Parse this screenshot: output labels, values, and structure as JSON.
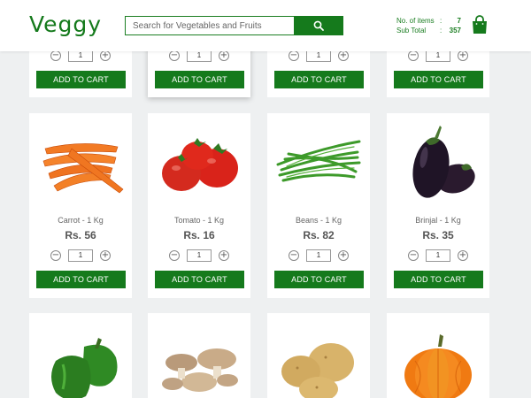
{
  "header": {
    "logo": "Veggy",
    "search": {
      "placeholder": "Search for Vegetables and Fruits"
    },
    "summary": {
      "items_label": "No. of items",
      "items_value": "7",
      "subtotal_label": "Sub Total",
      "subtotal_value": "357",
      "separator": ":"
    }
  },
  "colors": {
    "brand": "#157a1c",
    "background": "#eef0f1"
  },
  "add_to_cart_label": "ADD TO CART",
  "row0": [
    {
      "qty": "1"
    },
    {
      "qty": "1"
    },
    {
      "qty": "1"
    },
    {
      "qty": "1"
    }
  ],
  "row1": [
    {
      "name": "Carrot - 1 Kg",
      "price": "Rs. 56",
      "qty": "1"
    },
    {
      "name": "Tomato - 1 Kg",
      "price": "Rs. 16",
      "qty": "1"
    },
    {
      "name": "Beans - 1 Kg",
      "price": "Rs. 82",
      "qty": "1"
    },
    {
      "name": "Brinjal - 1 Kg",
      "price": "Rs. 35",
      "qty": "1"
    }
  ],
  "row2": [
    {
      "image": "capsicum"
    },
    {
      "image": "mushroom"
    },
    {
      "image": "potato"
    },
    {
      "image": "pumpkin"
    }
  ],
  "qty_controls": {
    "minus": "−",
    "plus": "+"
  }
}
